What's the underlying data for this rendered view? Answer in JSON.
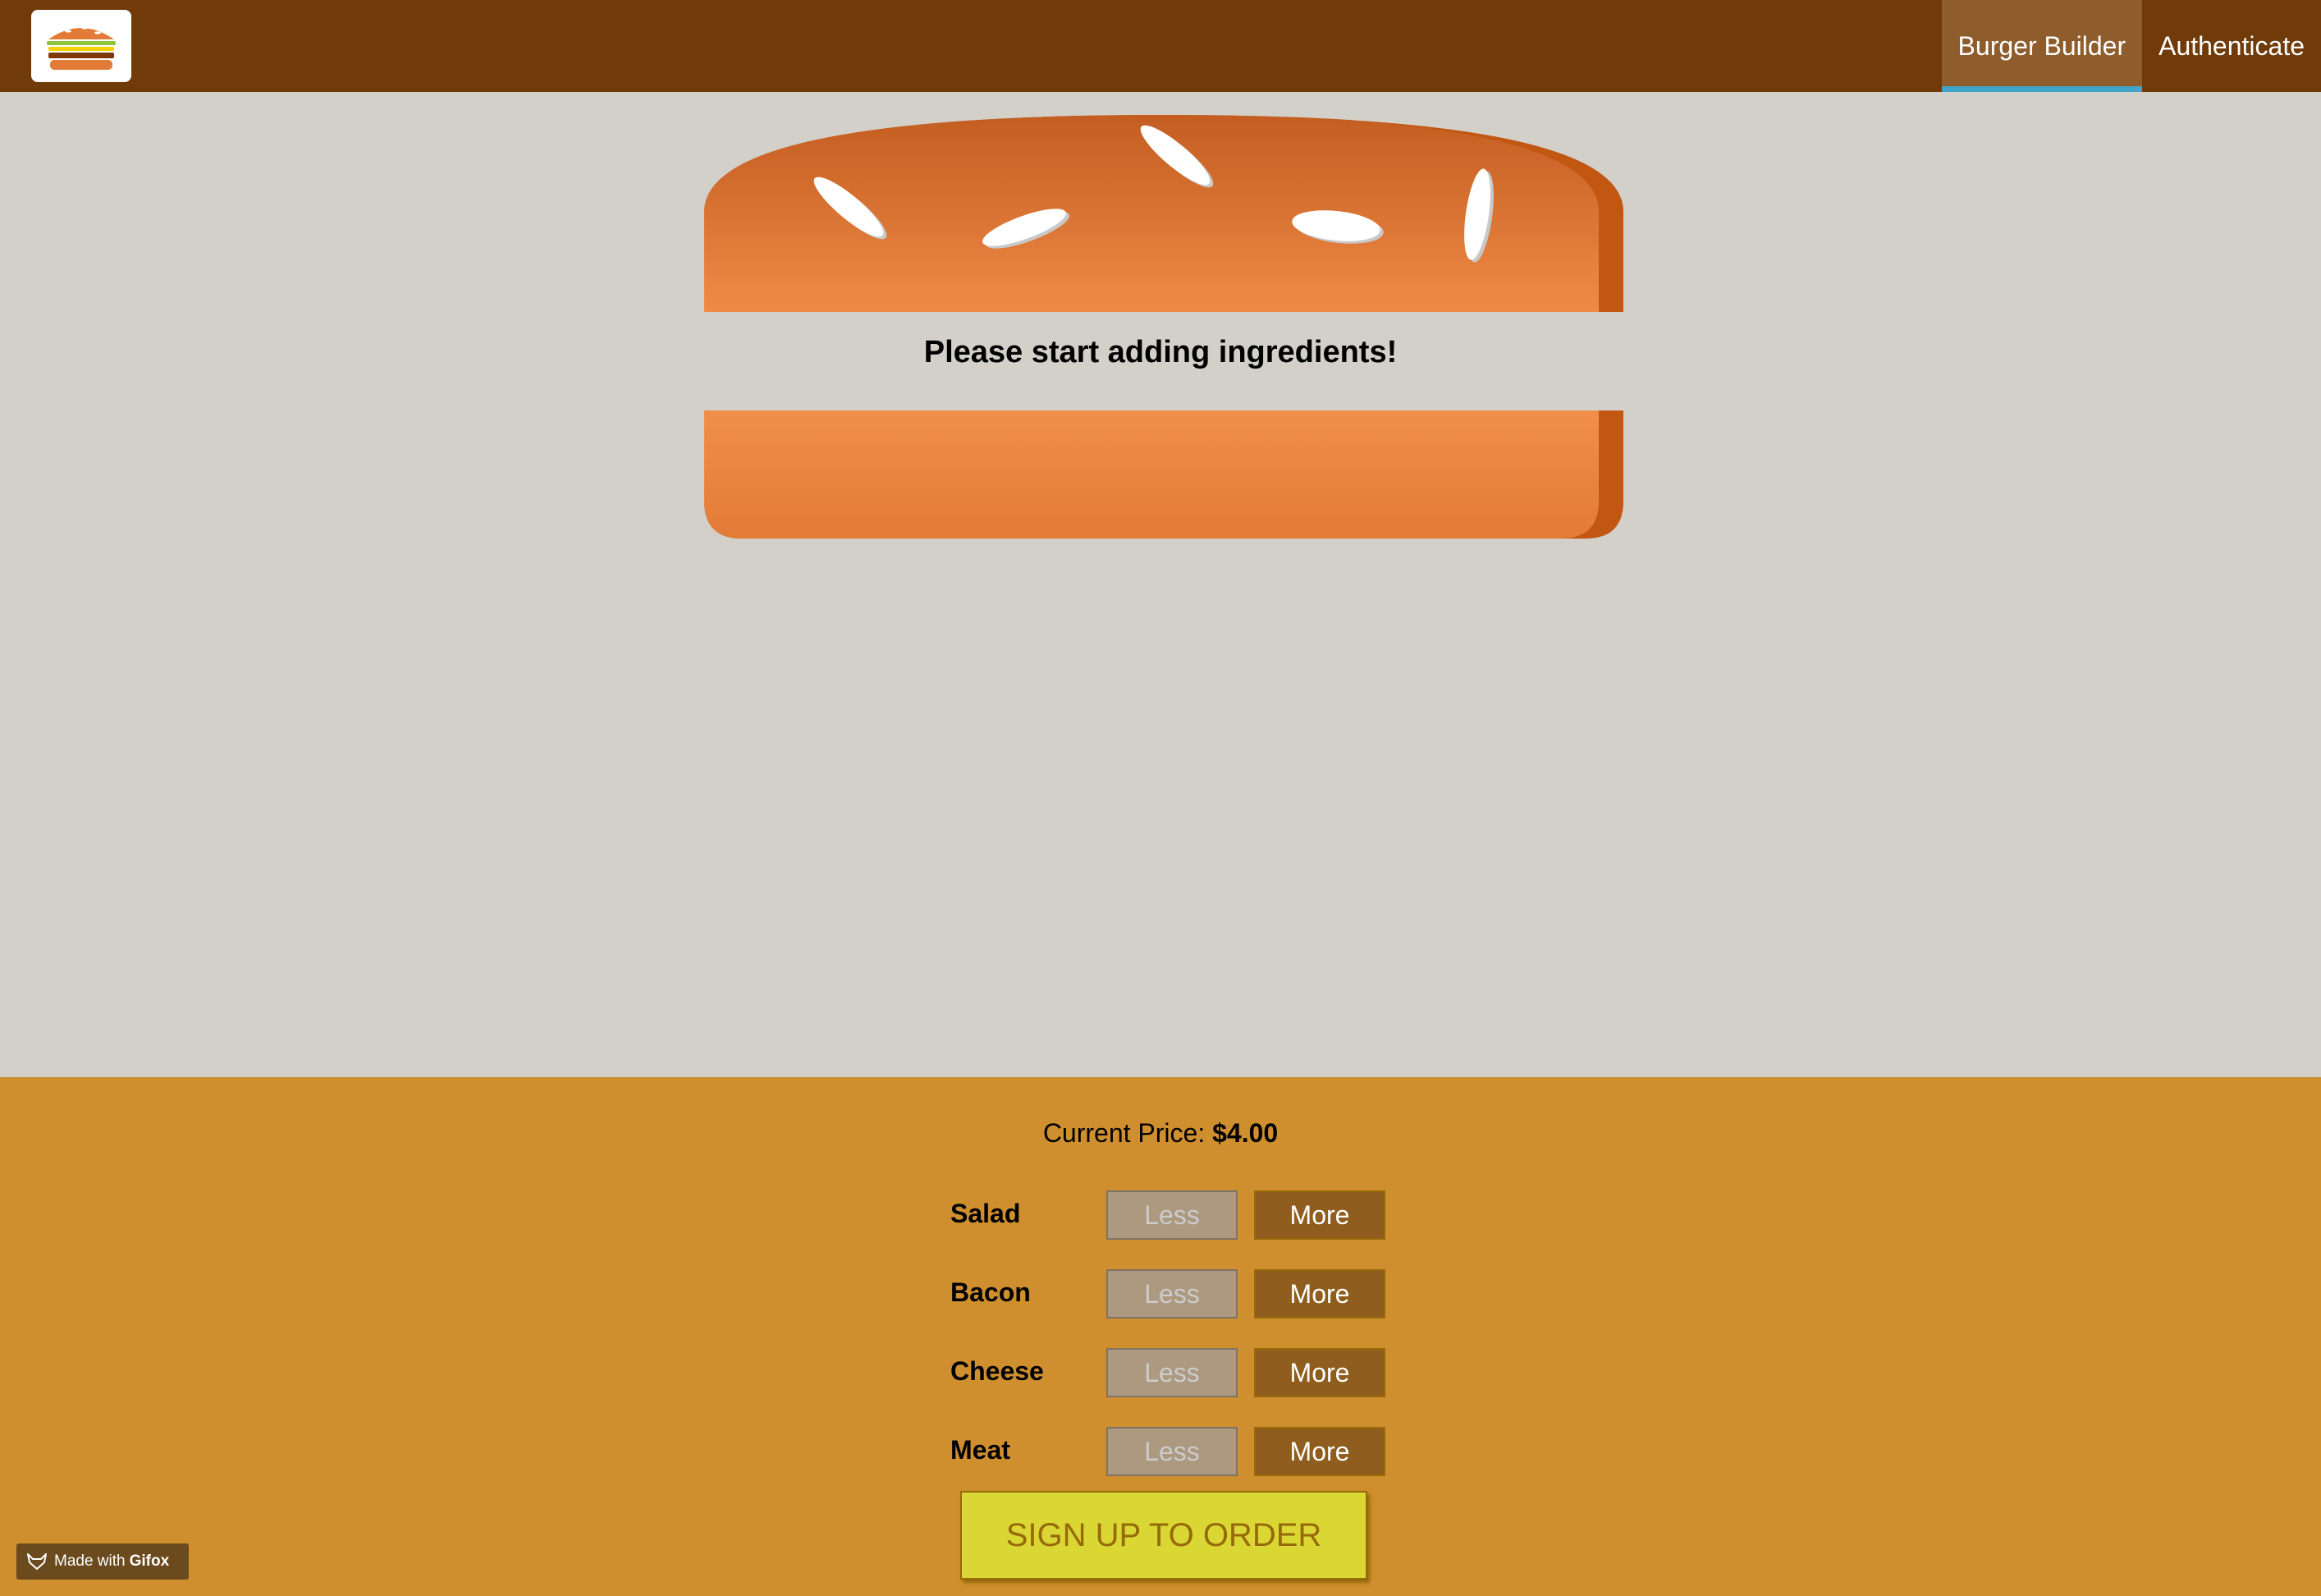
{
  "header": {
    "nav": [
      {
        "label": "Burger Builder",
        "active": true
      },
      {
        "label": "Authenticate",
        "active": false
      }
    ],
    "accent": "#40a4c8"
  },
  "burger": {
    "message": "Please start adding ingredients!"
  },
  "controls": {
    "price_label": "Current Price:",
    "price_value": "$4.00",
    "less_label": "Less",
    "more_label": "More",
    "ingredients": [
      {
        "label": "Salad"
      },
      {
        "label": "Bacon"
      },
      {
        "label": "Cheese"
      },
      {
        "label": "Meat"
      }
    ],
    "order_label": "SIGN UP TO ORDER"
  },
  "badge": {
    "prefix": "Made with",
    "brand": "Gifox"
  },
  "colors": {
    "toolbar": "#703b09",
    "controls_bg": "#cf8f2e",
    "order_button": "#dad735"
  }
}
